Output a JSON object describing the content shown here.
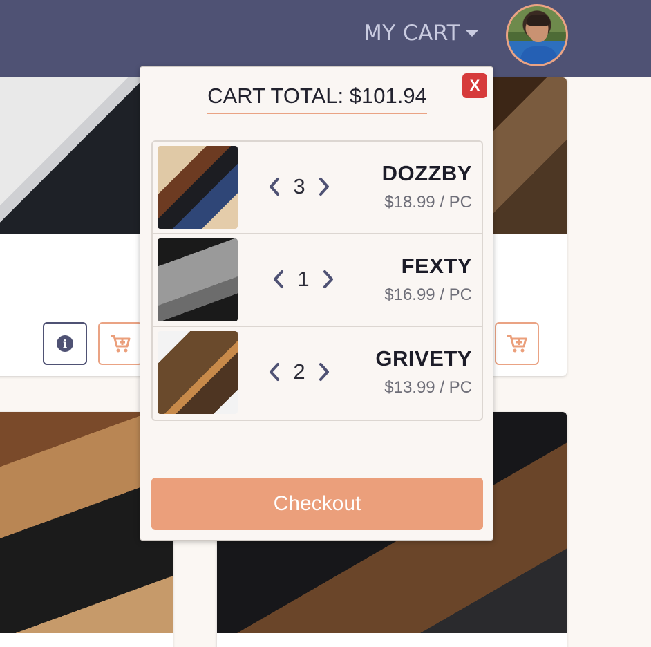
{
  "header": {
    "cart_toggle_label": "MY CART",
    "caret_icon": "caret-down-icon",
    "avatar": "user-avatar"
  },
  "cart": {
    "total_label": "CART TOTAL: $101.94",
    "close_label": "X",
    "checkout_label": "Checkout",
    "items": [
      {
        "name": "DOZZBY",
        "quantity": "3",
        "price": "$18.99 / PC"
      },
      {
        "name": "FEXTY",
        "quantity": "1",
        "price": "$16.99 / PC"
      },
      {
        "name": "GRIVETY",
        "quantity": "2",
        "price": "$13.99 / PC"
      }
    ]
  },
  "background": {
    "info_icon": "info-icon",
    "cart_add_icon": "cart-plus-icon"
  },
  "colors": {
    "header_bg": "#4f5274",
    "accent": "#eb9f7b",
    "close_red": "#d63b3b",
    "page_bg": "#fbf7f3"
  }
}
